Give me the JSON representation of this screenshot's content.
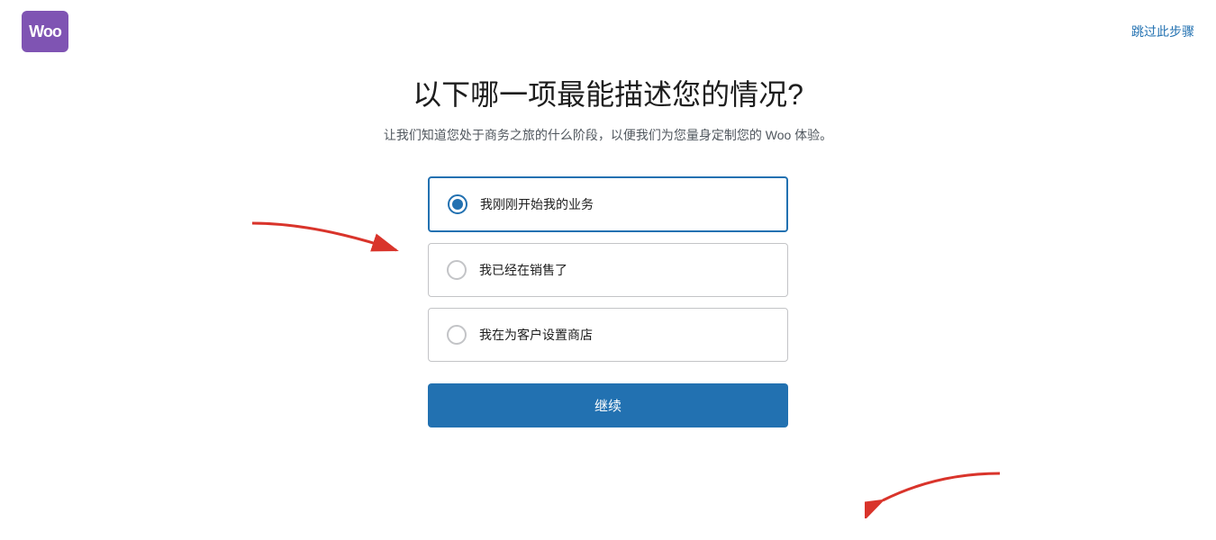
{
  "header": {
    "logo_text": "Woo",
    "skip_label": "跳过此步骤"
  },
  "page": {
    "title": "以下哪一项最能描述您的情况?",
    "subtitle": "让我们知道您处于商务之旅的什么阶段，以便我们为您量身定制您的 Woo 体验。"
  },
  "options": [
    {
      "id": "option1",
      "label": "我刚刚开始我的业务",
      "selected": true
    },
    {
      "id": "option2",
      "label": "我已经在销售了",
      "selected": false
    },
    {
      "id": "option3",
      "label": "我在为客户设置商店",
      "selected": false
    }
  ],
  "continue_button": {
    "label": "继续"
  }
}
